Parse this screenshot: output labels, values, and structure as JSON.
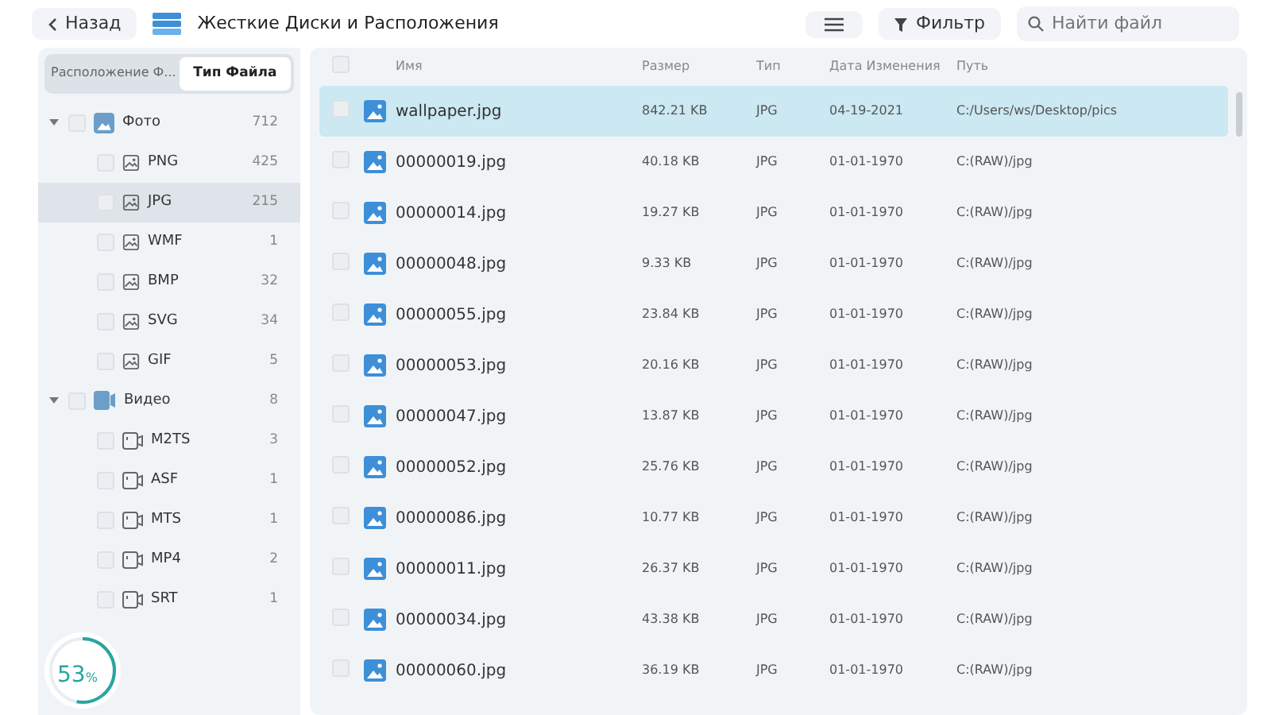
{
  "toolbar": {
    "back_label": "Назад",
    "title": "Жесткие Диски и Расположения",
    "filter_label": "Фильтр",
    "search": {
      "placeholder": "Найти файл"
    }
  },
  "sidebar": {
    "tabs": [
      {
        "label": "Расположение Ф...",
        "selected": false
      },
      {
        "label": "Тип Файла",
        "selected": true
      }
    ],
    "tree": [
      {
        "kind": "photo",
        "label": "Фото",
        "count": "712",
        "expanded": true,
        "checked": false,
        "selected": false,
        "children": [
          {
            "kind": "photo",
            "label": "PNG",
            "count": "425",
            "checked": false,
            "selected": false
          },
          {
            "kind": "photo",
            "label": "JPG",
            "count": "215",
            "checked": false,
            "selected": true
          },
          {
            "kind": "photo",
            "label": "WMF",
            "count": "1",
            "checked": false,
            "selected": false
          },
          {
            "kind": "photo",
            "label": "BMP",
            "count": "32",
            "checked": false,
            "selected": false
          },
          {
            "kind": "photo",
            "label": "SVG",
            "count": "34",
            "checked": false,
            "selected": false
          },
          {
            "kind": "photo",
            "label": "GIF",
            "count": "5",
            "checked": false,
            "selected": false
          }
        ]
      },
      {
        "kind": "video",
        "label": "Видео",
        "count": "8",
        "expanded": true,
        "checked": false,
        "selected": false,
        "children": [
          {
            "kind": "video",
            "label": "M2TS",
            "count": "3",
            "checked": false,
            "selected": false
          },
          {
            "kind": "video",
            "label": "ASF",
            "count": "1",
            "checked": false,
            "selected": false
          },
          {
            "kind": "video",
            "label": "MTS",
            "count": "1",
            "checked": false,
            "selected": false
          },
          {
            "kind": "video",
            "label": "MP4",
            "count": "2",
            "checked": false,
            "selected": false
          },
          {
            "kind": "video",
            "label": "SRT",
            "count": "1",
            "checked": false,
            "selected": false
          }
        ]
      }
    ]
  },
  "progress": {
    "value": "53",
    "unit": "%",
    "level": 0.53
  },
  "table": {
    "select_all_checked": false,
    "columns": [
      "Имя",
      "Размер",
      "Тип",
      "Дата Изменения",
      "Путь"
    ],
    "rows": [
      {
        "name": "wallpaper.jpg",
        "size": "842.21 KB",
        "type": "JPG",
        "date": "04-19-2021",
        "path": "C:/Users/ws/Desktop/pics",
        "selected": true,
        "checked": false
      },
      {
        "name": "00000019.jpg",
        "size": "40.18 KB",
        "type": "JPG",
        "date": "01-01-1970",
        "path": "C:(RAW)/jpg",
        "selected": false,
        "checked": false
      },
      {
        "name": "00000014.jpg",
        "size": "19.27 KB",
        "type": "JPG",
        "date": "01-01-1970",
        "path": "C:(RAW)/jpg",
        "selected": false,
        "checked": false
      },
      {
        "name": "00000048.jpg",
        "size": "9.33 KB",
        "type": "JPG",
        "date": "01-01-1970",
        "path": "C:(RAW)/jpg",
        "selected": false,
        "checked": false
      },
      {
        "name": "00000055.jpg",
        "size": "23.84 KB",
        "type": "JPG",
        "date": "01-01-1970",
        "path": "C:(RAW)/jpg",
        "selected": false,
        "checked": false
      },
      {
        "name": "00000053.jpg",
        "size": "20.16 KB",
        "type": "JPG",
        "date": "01-01-1970",
        "path": "C:(RAW)/jpg",
        "selected": false,
        "checked": false
      },
      {
        "name": "00000047.jpg",
        "size": "13.87 KB",
        "type": "JPG",
        "date": "01-01-1970",
        "path": "C:(RAW)/jpg",
        "selected": false,
        "checked": false
      },
      {
        "name": "00000052.jpg",
        "size": "25.76 KB",
        "type": "JPG",
        "date": "01-01-1970",
        "path": "C:(RAW)/jpg",
        "selected": false,
        "checked": false
      },
      {
        "name": "00000086.jpg",
        "size": "10.77 KB",
        "type": "JPG",
        "date": "01-01-1970",
        "path": "C:(RAW)/jpg",
        "selected": false,
        "checked": false
      },
      {
        "name": "00000011.jpg",
        "size": "26.37 KB",
        "type": "JPG",
        "date": "01-01-1970",
        "path": "C:(RAW)/jpg",
        "selected": false,
        "checked": false
      },
      {
        "name": "00000034.jpg",
        "size": "43.38 KB",
        "type": "JPG",
        "date": "01-01-1970",
        "path": "C:(RAW)/jpg",
        "selected": false,
        "checked": false
      },
      {
        "name": "00000060.jpg",
        "size": "36.19 KB",
        "type": "JPG",
        "date": "01-01-1970",
        "path": "C:(RAW)/jpg",
        "selected": false,
        "checked": false
      }
    ]
  }
}
